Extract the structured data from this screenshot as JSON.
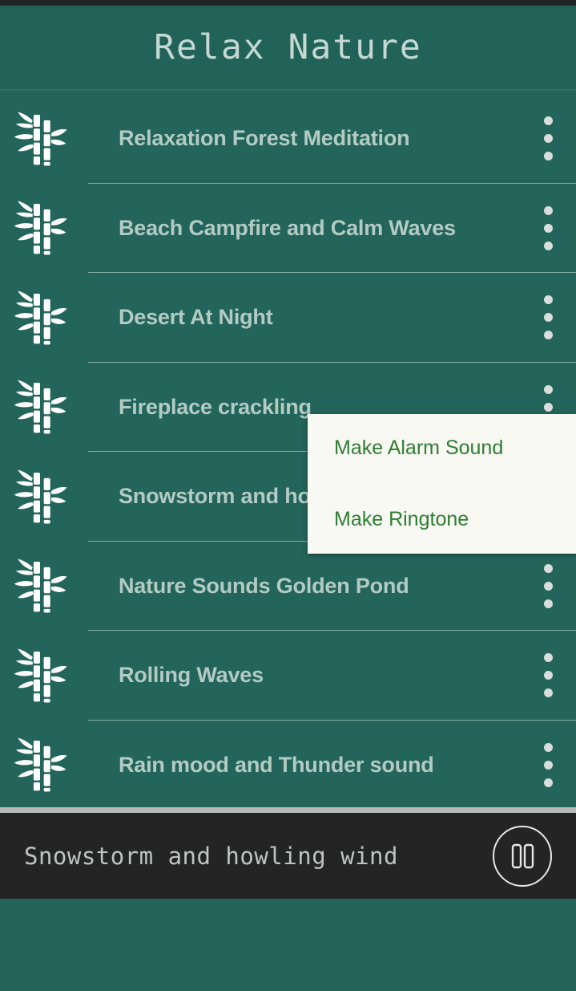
{
  "header": {
    "title": "Relax Nature"
  },
  "icons": {
    "track": "bamboo-icon",
    "overflow": "more-vertical-icon",
    "transport": "pause-icon"
  },
  "colors": {
    "background": "#23655a",
    "header_bg": "#216358",
    "title_text": "#c5d8d1",
    "track_text": "#b3cbc3",
    "divider": "#87aca3",
    "popup_bg": "#f8f9f3",
    "popup_text": "#2e7d32",
    "player_bg": "#242424",
    "player_text": "#bfc4c1",
    "status_bar": "#232323"
  },
  "track_list": [
    {
      "title": "Relaxation Forest Meditation"
    },
    {
      "title": "Beach Campfire and Calm Waves"
    },
    {
      "title": "Desert At Night"
    },
    {
      "title": "Fireplace crackling"
    },
    {
      "title": "Snowstorm and howling wind"
    },
    {
      "title": "Nature Sounds Golden Pond"
    },
    {
      "title": "Rolling Waves"
    },
    {
      "title": "Rain mood and Thunder sound"
    }
  ],
  "popup_menu": {
    "items": [
      {
        "label": "Make Alarm Sound"
      },
      {
        "label": "Make Ringtone"
      }
    ]
  },
  "player": {
    "now_playing": "Snowstorm and howling wind",
    "transport_state": "playing"
  }
}
